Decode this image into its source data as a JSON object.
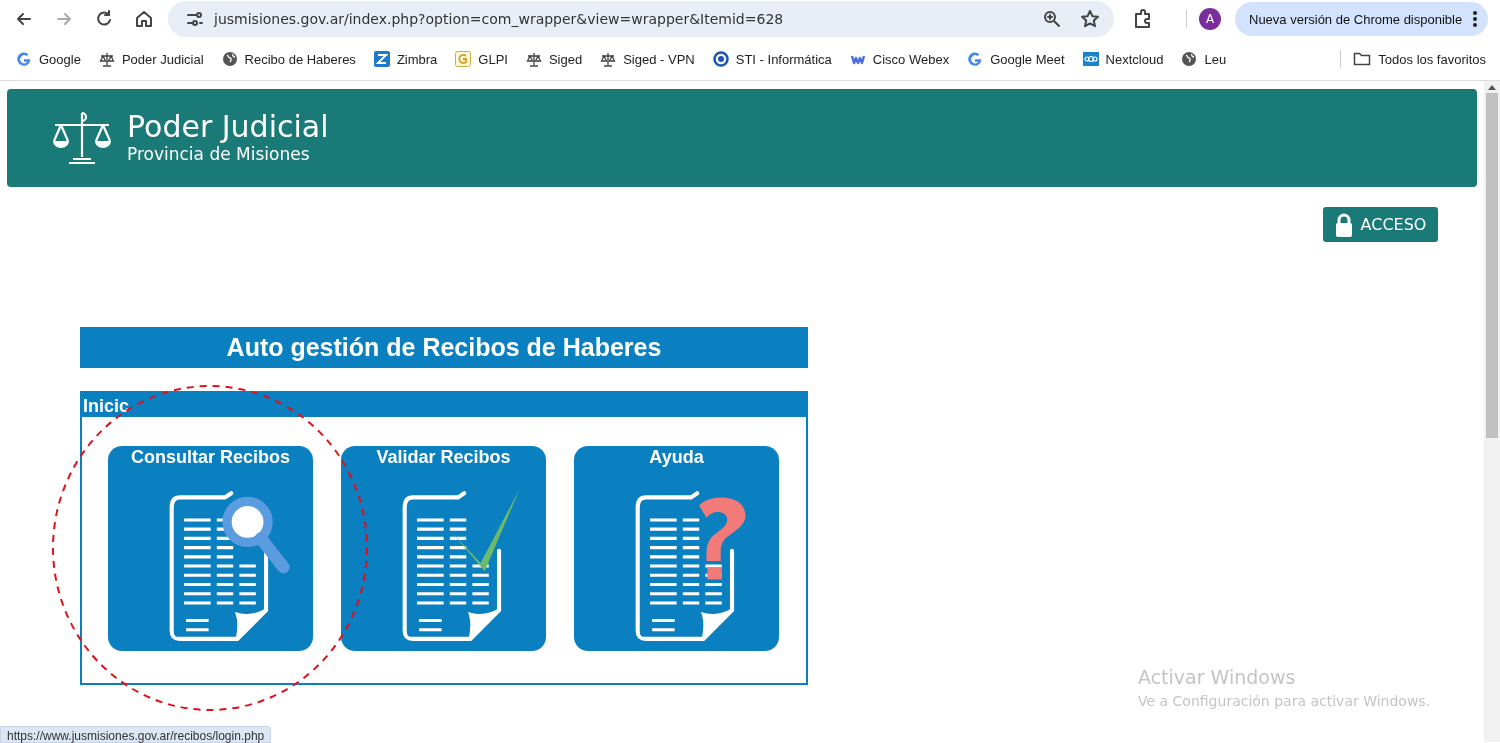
{
  "browser": {
    "url": "jusmisiones.gov.ar/index.php?option=com_wrapper&view=wrapper&Itemid=628",
    "profile_initial": "A",
    "update_notice": "Nueva versión de Chrome disponible"
  },
  "bookmarks": [
    {
      "label": "Google",
      "kind": "g"
    },
    {
      "label": "Poder Judicial",
      "kind": "scales"
    },
    {
      "label": "Recibo de Haberes",
      "kind": "globe"
    },
    {
      "label": "Zimbra",
      "kind": "letter"
    },
    {
      "label": "GLPI",
      "kind": "glpi"
    },
    {
      "label": "Siged",
      "kind": "scales"
    },
    {
      "label": "Siged - VPN",
      "kind": "scales"
    },
    {
      "label": "STI - Informática",
      "kind": "ring"
    },
    {
      "label": "Cisco Webex",
      "kind": "webex"
    },
    {
      "label": "Google Meet",
      "kind": "g"
    },
    {
      "label": "Nextcloud",
      "kind": "cloud"
    },
    {
      "label": "Leu",
      "kind": "globe"
    }
  ],
  "all_bookmarks": "Todos los favoritos",
  "header": {
    "title": "Poder Judicial",
    "subtitle": "Provincia de Misiones"
  },
  "access_button": "ACCESO",
  "page_title": "Auto gestión de Recibos de Haberes",
  "panel": {
    "title": "Inicic",
    "tiles": [
      {
        "label": "Consultar Recibos",
        "kind": "search"
      },
      {
        "label": "Validar Recibos",
        "kind": "check"
      },
      {
        "label": "Ayuda",
        "kind": "question"
      }
    ]
  },
  "status_url": "https://www.jusmisiones.gov.ar/recibos/login.php",
  "windows_notice": {
    "title": "Activar Windows",
    "text": "Ve a Configuración para activar Windows."
  }
}
